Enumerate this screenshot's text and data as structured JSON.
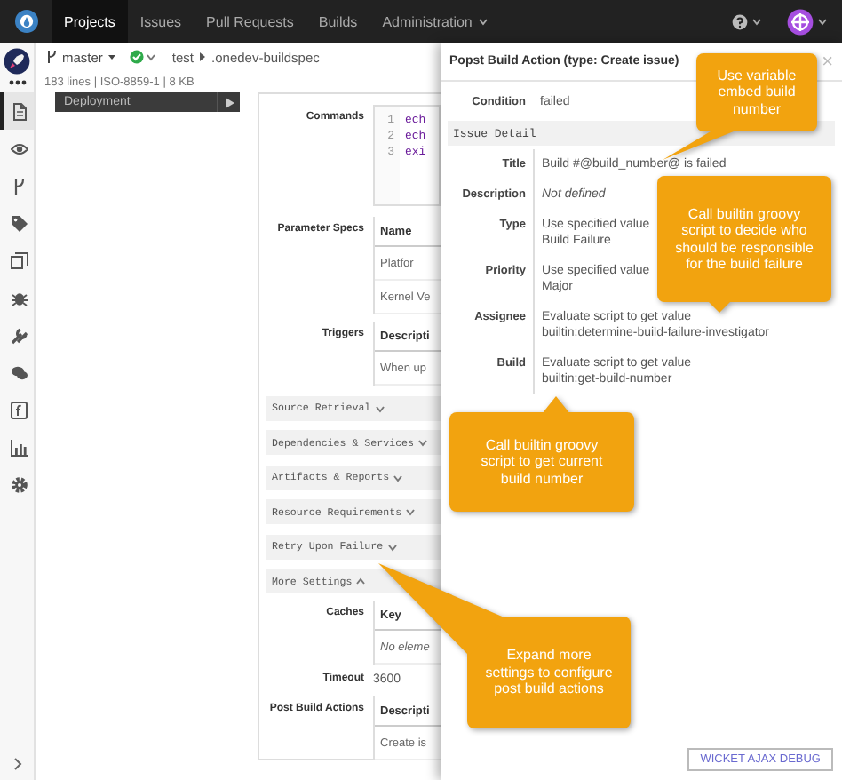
{
  "nav": {
    "tabs": [
      {
        "label": "Projects",
        "selected": true,
        "menu": false
      },
      {
        "label": "Issues",
        "selected": false,
        "menu": false
      },
      {
        "label": "Pull Requests",
        "selected": false,
        "menu": false
      },
      {
        "label": "Builds",
        "selected": false,
        "menu": false
      },
      {
        "label": "Administration",
        "selected": false,
        "menu": true
      }
    ]
  },
  "sidebar": {
    "items": [
      {
        "kind": "file",
        "selected": true
      },
      {
        "kind": "eye",
        "selected": false
      },
      {
        "kind": "branch",
        "selected": false
      },
      {
        "kind": "tag",
        "selected": false
      },
      {
        "kind": "copy",
        "selected": false
      },
      {
        "kind": "bug",
        "selected": false
      },
      {
        "kind": "wrench",
        "selected": false
      },
      {
        "kind": "chat",
        "selected": false
      },
      {
        "kind": "code",
        "selected": false
      },
      {
        "kind": "chart",
        "selected": false
      },
      {
        "kind": "gear",
        "selected": false
      }
    ]
  },
  "breadcrumb": {
    "branch": "master",
    "path": [
      "test",
      ".onedev-buildspec"
    ]
  },
  "file_info": "183 lines | ISO-8859-1 | 8 KB",
  "job": {
    "name": "Deployment"
  },
  "form_top": [
    {
      "label": "Commands",
      "kind": "editor",
      "lines": [
        {
          "number": "1",
          "text": "ech"
        },
        {
          "number": "2",
          "text": "ech"
        },
        {
          "number": "3",
          "text": "exi"
        }
      ]
    },
    {
      "label": "Parameter Specs",
      "kind": "table",
      "column": "Name",
      "rows": [
        "Platfor",
        "Kernel Ve"
      ]
    },
    {
      "label": "Triggers",
      "kind": "table",
      "column": "Descripti",
      "rows": [
        "When up"
      ]
    }
  ],
  "sections": [
    {
      "label": "Source Retrieval",
      "expanded": false
    },
    {
      "label": "Dependencies & Services",
      "expanded": false
    },
    {
      "label": "Artifacts & Reports",
      "expanded": false
    },
    {
      "label": "Resource Requirements",
      "expanded": false
    },
    {
      "label": "Retry Upon Failure",
      "expanded": false
    },
    {
      "label": "More Settings",
      "expanded": true
    }
  ],
  "form_bottom": [
    {
      "label": "Caches",
      "kind": "table",
      "column": "Key",
      "empty": "No eleme"
    },
    {
      "label": "Timeout",
      "kind": "text",
      "value": "3600"
    },
    {
      "label": "Post Build Actions",
      "kind": "table",
      "column": "Descripti",
      "rows": [
        "Create is"
      ]
    }
  ],
  "panel": {
    "title": "Popst Build Action (type: Create issue)",
    "close": "×",
    "fields": [
      {
        "label": "Condition",
        "lines": [
          "failed"
        ]
      }
    ],
    "group": "Issue Detail",
    "details": [
      {
        "label": "Title",
        "kind": "value",
        "lines": [
          "Build #@build_number@ is failed"
        ]
      },
      {
        "label": "Description",
        "kind": "undefined",
        "lines": [
          "Not defined"
        ]
      },
      {
        "label": "Type",
        "kind": "value",
        "lines": [
          "Use specified value",
          "Build Failure"
        ]
      },
      {
        "label": "Priority",
        "kind": "value",
        "lines": [
          "Use specified value",
          "Major"
        ]
      },
      {
        "label": "Assignee",
        "kind": "value",
        "lines": [
          "Evaluate script to get value",
          "builtin:determine-build-failure-investigator"
        ]
      },
      {
        "label": "Build",
        "kind": "value",
        "lines": [
          "Evaluate script to get value",
          "builtin:get-build-number"
        ]
      }
    ],
    "debug_button": "WICKET AJAX DEBUG"
  },
  "callouts": [
    {
      "text": "Use variable embed build number"
    },
    {
      "text": "Call builtin groovy script to decide who should be responsible for the build failure"
    },
    {
      "text": "Call builtin groovy script to get current build number"
    },
    {
      "text": "Expand more settings to configure post build actions"
    }
  ]
}
